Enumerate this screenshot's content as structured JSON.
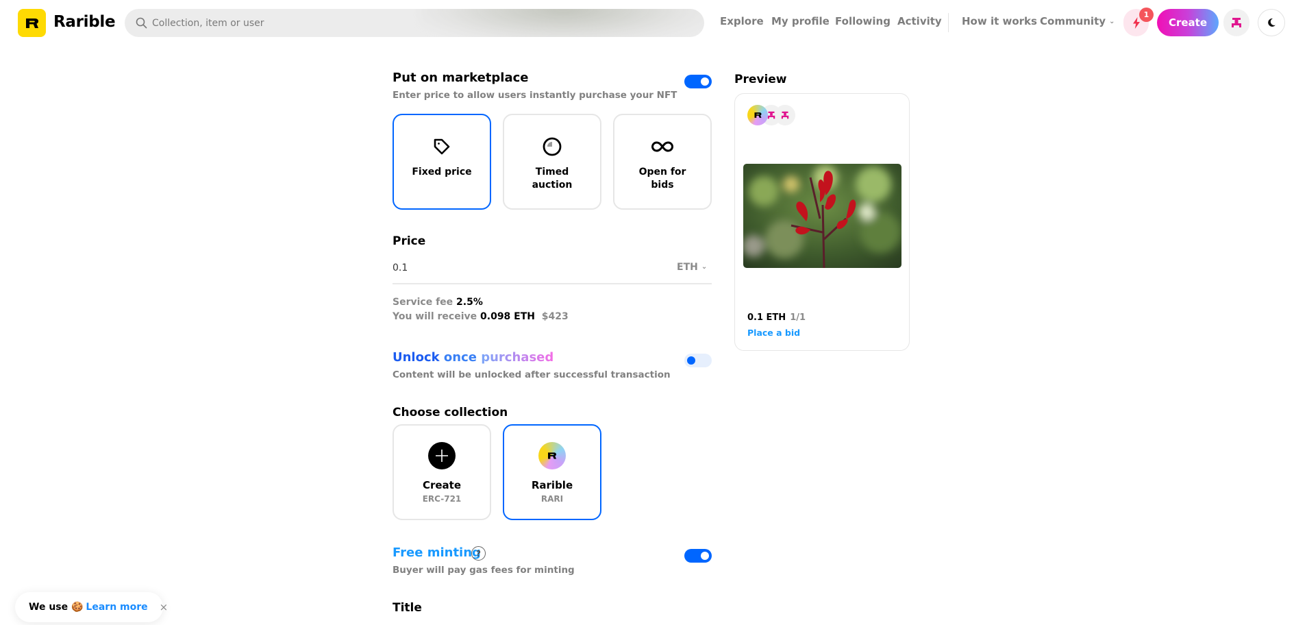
{
  "header": {
    "brand": "Rarible",
    "search_placeholder": "Collection, item or user",
    "nav": [
      "Explore",
      "My profile",
      "Following",
      "Activity",
      "How it works",
      "Community"
    ],
    "notification_count": "1",
    "create_label": "Create",
    "icons": {
      "logo": "rarible-r-logo",
      "search": "magnifier",
      "notifications": "lightning-bolt",
      "profile": "user-avatar",
      "theme": "moon"
    }
  },
  "marketplace": {
    "title": "Put on marketplace",
    "subtitle": "Enter price to allow users instantly purchase your NFT",
    "enabled": true,
    "sale_types": [
      {
        "label": "Fixed price",
        "icon": "price-tag",
        "selected": true
      },
      {
        "label": "Timed auction",
        "icon": "clock",
        "selected": false
      },
      {
        "label": "Open for bids",
        "icon": "infinity",
        "selected": false
      }
    ]
  },
  "price": {
    "label": "Price",
    "value": "0.1",
    "currency": "ETH",
    "service_fee_label": "Service fee",
    "service_fee_value": "2.5%",
    "receive_label": "You will receive",
    "receive_eth": "0.098 ETH",
    "receive_usd": "$423"
  },
  "unlock": {
    "title_parts": [
      "Unlock",
      "once",
      "purchased"
    ],
    "subtitle": "Content will be unlocked after successful transaction",
    "enabled": false
  },
  "collection": {
    "title": "Choose collection",
    "items": [
      {
        "name": "Create",
        "ticker": "ERC-721",
        "icon": "plus",
        "selected": false
      },
      {
        "name": "Rarible",
        "ticker": "RARI",
        "icon": "rarible-r-logo",
        "selected": true
      }
    ]
  },
  "free_minting": {
    "title": "Free minting",
    "subtitle": "Buyer will pay gas fees for minting",
    "help": "?",
    "enabled": true
  },
  "title_field": {
    "label": "Title"
  },
  "preview": {
    "label": "Preview",
    "price": "0.1 ETH",
    "edition": "1/1",
    "action": "Place a bid",
    "image": "red canna flower on blurred green background"
  },
  "cookie": {
    "text": "We use",
    "emoji": "🍪",
    "link": "Learn more",
    "close": "×"
  },
  "colors": {
    "accent_blue": "#0066ff",
    "link_blue": "#1899ff",
    "brand_yellow": "#FEDA03",
    "badge_red": "#f4555b",
    "create_gradient_start": "#f10fb5",
    "create_gradient_end": "#5ea7fd"
  }
}
